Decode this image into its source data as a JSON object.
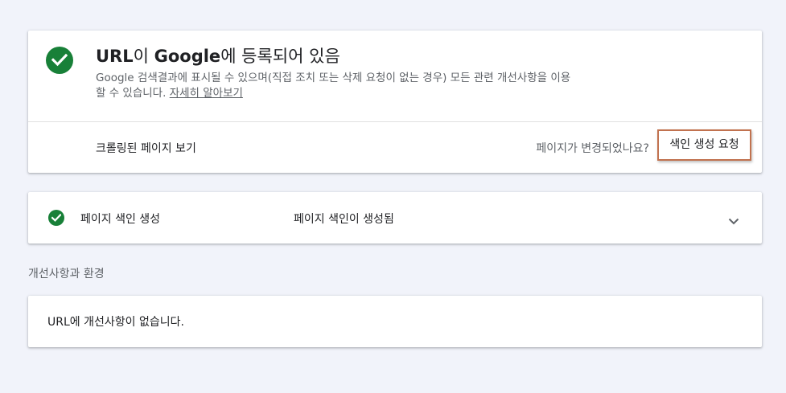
{
  "status_card": {
    "title_prefix": "URL",
    "title_josa1": "이 ",
    "title_brand": "Google",
    "title_suffix": "에 등록되어 있음",
    "description": "Google 검색결과에 표시될 수 있으며(직접 조치 또는 삭제 요청이 없는 경우) 모든 관련 개선사항을 이용할 수 있습니다.",
    "learn_more_label": "자세히 알아보기",
    "crawled_page_label": "크롤링된 페이지 보기",
    "changed_question": "페이지가 변경되었나요?",
    "request_indexing_label": "색인 생성 요청"
  },
  "index_card": {
    "label": "페이지 색인 생성",
    "value": "페이지 색인이 생성됨"
  },
  "enhancements": {
    "heading": "개선사항과 환경",
    "message": "URL에 개선사항이 없습니다."
  },
  "colors": {
    "background": "#f1f3fa",
    "success_green": "#188038",
    "highlight_border": "#c1724f"
  },
  "icons": [
    "check-circle-icon",
    "chevron-down-icon"
  ]
}
